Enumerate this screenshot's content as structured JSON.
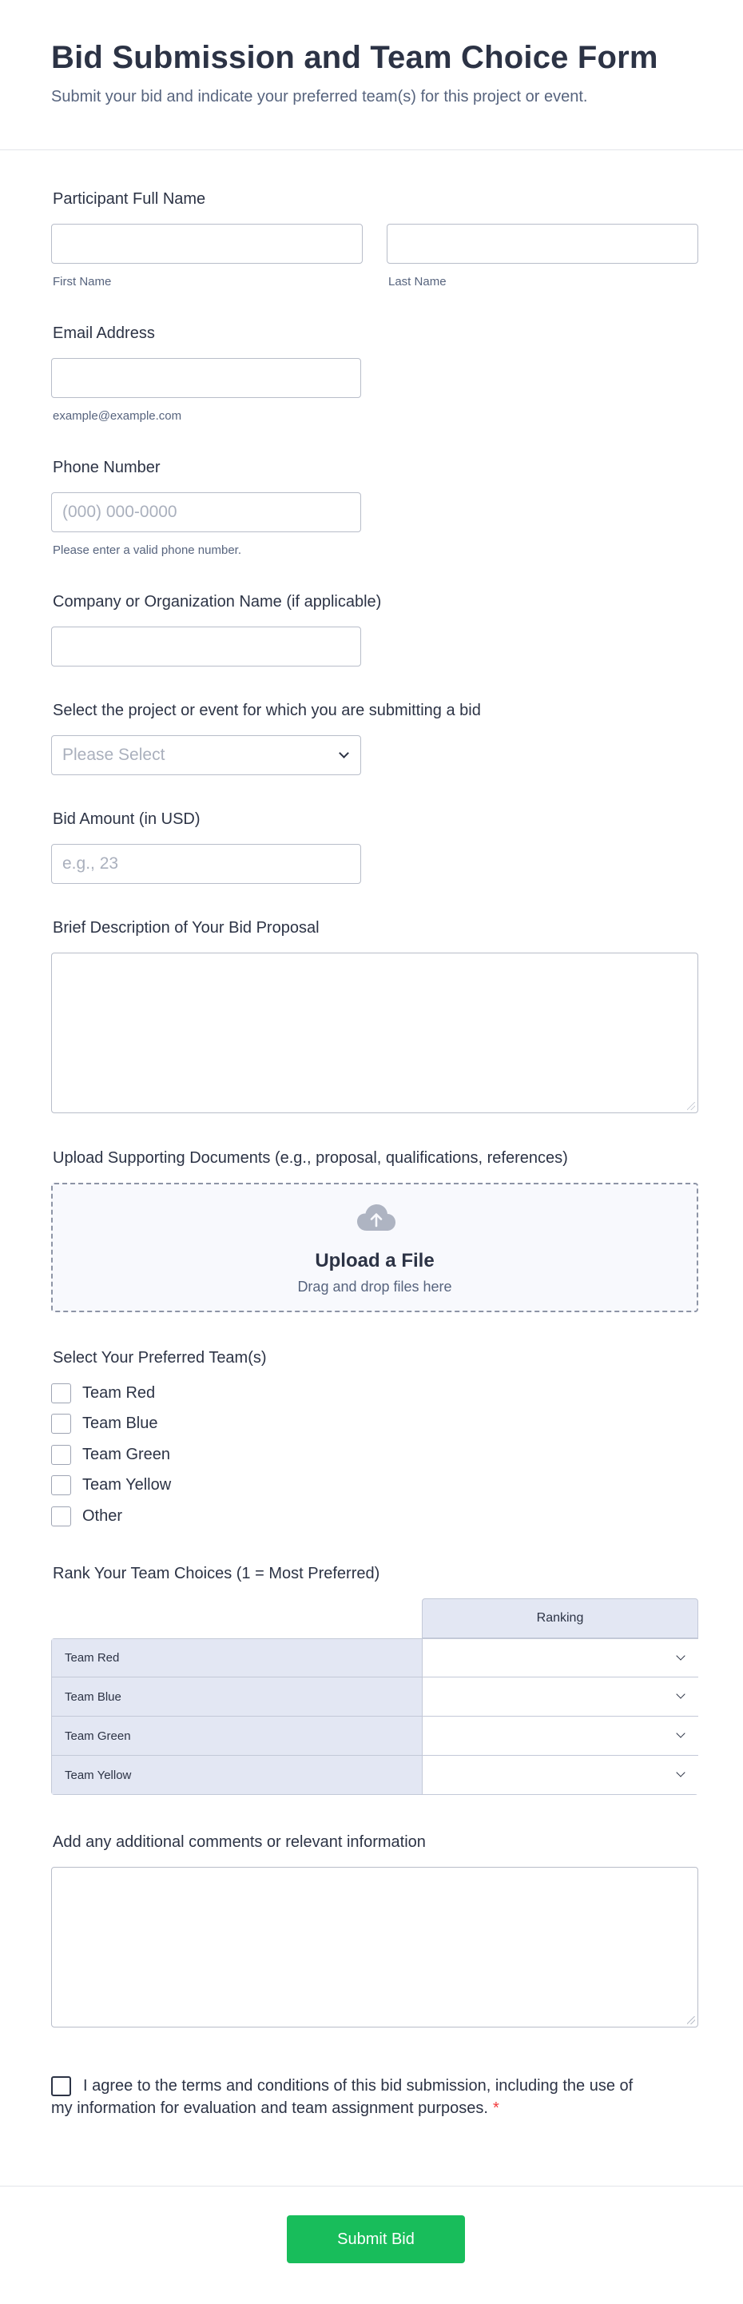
{
  "header": {
    "title": "Bid Submission and Team Choice Form",
    "subtitle": "Submit your bid and indicate your preferred team(s) for this project or event."
  },
  "fields": {
    "full_name": {
      "label": "Participant Full Name",
      "first_sublabel": "First Name",
      "last_sublabel": "Last Name",
      "first_value": "",
      "last_value": ""
    },
    "email": {
      "label": "Email Address",
      "sublabel": "example@example.com",
      "value": ""
    },
    "phone": {
      "label": "Phone Number",
      "placeholder": "(000) 000-0000",
      "sublabel": "Please enter a valid phone number."
    },
    "company": {
      "label": "Company or Organization Name (if applicable)",
      "value": ""
    },
    "project": {
      "label": "Select the project or event for which you are submitting a bid",
      "selected": "Please Select"
    },
    "bid_amount": {
      "label": "Bid Amount (in USD)",
      "placeholder": "e.g., 23"
    },
    "description": {
      "label": "Brief Description of Your Bid Proposal",
      "value": ""
    },
    "upload": {
      "label": "Upload Supporting Documents (e.g., proposal, qualifications, references)",
      "title": "Upload a File",
      "hint": "Drag and drop files here",
      "icon": "cloud-upload-icon"
    },
    "teams": {
      "label": "Select Your Preferred Team(s)",
      "options": [
        "Team Red",
        "Team Blue",
        "Team Green",
        "Team Yellow",
        "Other"
      ]
    },
    "ranking": {
      "label": "Rank Your Team Choices (1 = Most Preferred)",
      "column": "Ranking",
      "rows": [
        "Team Red",
        "Team Blue",
        "Team Green",
        "Team Yellow"
      ]
    },
    "comments": {
      "label": "Add any additional comments or relevant information",
      "value": ""
    },
    "terms": {
      "text": "I agree to the terms and conditions of this bid submission, including the use of my information for evaluation and team assignment purposes.",
      "required_mark": "*"
    }
  },
  "footer": {
    "submit_label": "Submit Bid"
  },
  "colors": {
    "accent": "#18bd5b",
    "required": "#f23a3c",
    "text": "#2c3345",
    "muted": "#57647e",
    "border": "#b8bdc9",
    "matrix_bg": "#e3e7f3"
  }
}
